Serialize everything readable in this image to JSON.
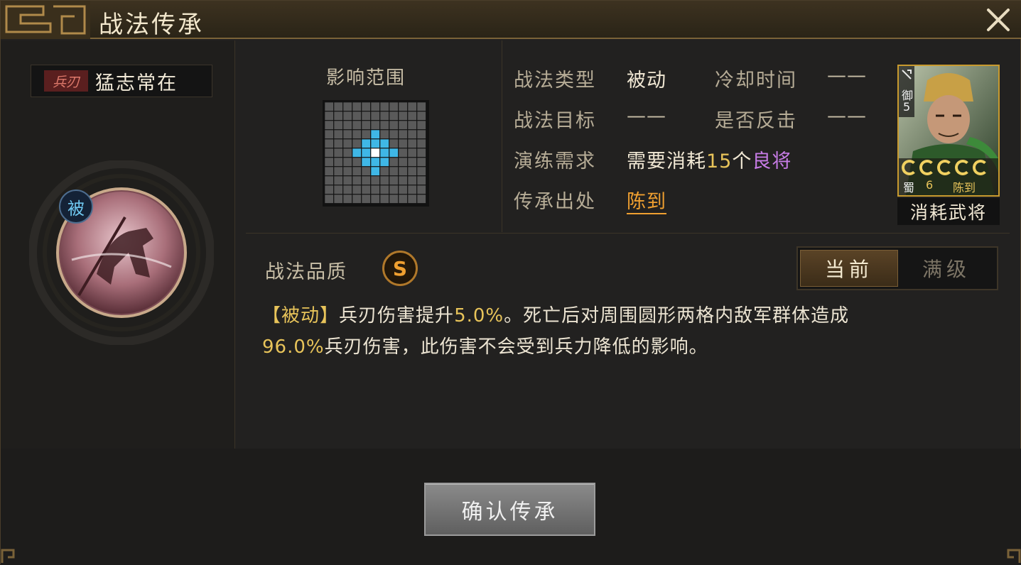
{
  "window": {
    "title": "战法传承"
  },
  "skill": {
    "type_tag": "兵刃",
    "name": "猛志常在",
    "passive_badge": "被",
    "quality_label": "战法品质",
    "quality": "S"
  },
  "range": {
    "label": "影响范围",
    "grid_size": 11,
    "highlight_cells": [
      [
        3,
        5
      ],
      [
        4,
        4
      ],
      [
        4,
        5
      ],
      [
        4,
        6
      ],
      [
        5,
        3
      ],
      [
        5,
        4
      ],
      [
        5,
        6
      ],
      [
        5,
        7
      ],
      [
        6,
        4
      ],
      [
        6,
        5
      ],
      [
        6,
        6
      ],
      [
        7,
        5
      ]
    ],
    "center_cell": [
      5,
      5
    ]
  },
  "info": {
    "type_label": "战法类型",
    "type_value": "被动",
    "cooldown_label": "冷却时间",
    "cooldown_value": "——",
    "target_label": "战法目标",
    "target_value": "——",
    "counter_label": "是否反击",
    "counter_value": "——",
    "train_label": "演练需求",
    "train_prefix": "需要消耗",
    "train_count": "15",
    "train_unit": "个",
    "train_item": "良将",
    "source_label": "传承出处",
    "source_value": "陈到"
  },
  "general_card": {
    "troop": "御",
    "troop_level": "5",
    "faction": "蜀",
    "cost": "6",
    "name": "陈到",
    "stars": 5,
    "consume_label": "消耗武将"
  },
  "level_toggle": {
    "current": "当前",
    "max": "满级"
  },
  "description": {
    "open": "【",
    "tag": "被动",
    "close": "】",
    "t1": "兵刃伤害提升",
    "v1": "5.0%",
    "t2": "。死亡后对周围圆形两格内敌军群体造成",
    "v2": "96.0%",
    "t3": "兵刃伤害，此伤害不会受到兵力降低的影响。"
  },
  "confirm_button": "确认传承",
  "colors": {
    "range_cell": "#5a5a5a",
    "range_highlight": "#3fb7e6",
    "range_center": "#ffffff",
    "gold": "#e8c45a",
    "orange_link": "#f0a030",
    "purple": "#c77ce6"
  }
}
